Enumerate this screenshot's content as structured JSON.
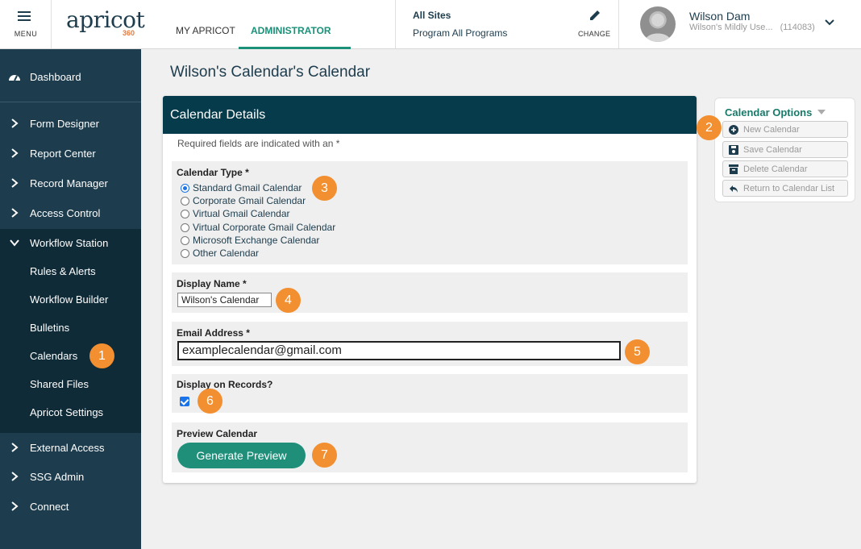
{
  "header": {
    "menu_label": "MENU",
    "logo_text": "apricot",
    "logo_sub": "360",
    "nav_my": "MY APRICOT",
    "nav_admin": "ADMINISTRATOR",
    "sites_title": "All Sites",
    "sites_program": "Program All Programs",
    "change_label": "CHANGE",
    "user_name": "Wilson Dam",
    "user_org": "Wilson's Mildly Use...",
    "user_id": "(114083)"
  },
  "sidebar": {
    "dashboard": "Dashboard",
    "items": [
      "Form Designer",
      "Report Center",
      "Record Manager",
      "Access Control",
      "Workflow Station"
    ],
    "sub_items": [
      "Rules & Alerts",
      "Workflow Builder",
      "Bulletins",
      "Calendars",
      "Shared Files",
      "Apricot Settings"
    ],
    "items_after": [
      "External Access",
      "SSG Admin",
      "Connect"
    ]
  },
  "page": {
    "title": "Wilson's Calendar's Calendar"
  },
  "card": {
    "title": "Calendar Details",
    "required_note": "Required fields are indicated with an *",
    "calendar_type_label": "Calendar Type *",
    "calendar_types": [
      "Standard Gmail Calendar",
      "Corporate Gmail Calendar",
      "Virtual Gmail Calendar",
      "Virtual Corporate Gmail Calendar",
      "Microsoft Exchange Calendar",
      "Other Calendar"
    ],
    "calendar_type_selected": "Standard Gmail Calendar",
    "display_name_label": "Display Name *",
    "display_name_value": "Wilson's Calendar",
    "email_label": "Email Address *",
    "email_value": "examplecalendar@gmail.com",
    "display_records_label": "Display on Records?",
    "display_records_checked": true,
    "preview_label": "Preview Calendar",
    "preview_button": "Generate Preview"
  },
  "options": {
    "title": "Calendar Options",
    "buttons": [
      "New Calendar",
      "Save Calendar",
      "Delete Calendar",
      "Return to Calendar List"
    ]
  },
  "badges": [
    "1",
    "2",
    "3",
    "4",
    "5",
    "6",
    "7"
  ],
  "colors": {
    "sidebar": "#1d3c4d",
    "sidebar_active": "#0f2b38",
    "card_header": "#063b4c",
    "accent": "#1a9178",
    "badge": "#f28f30",
    "button": "#1f8f7a"
  }
}
